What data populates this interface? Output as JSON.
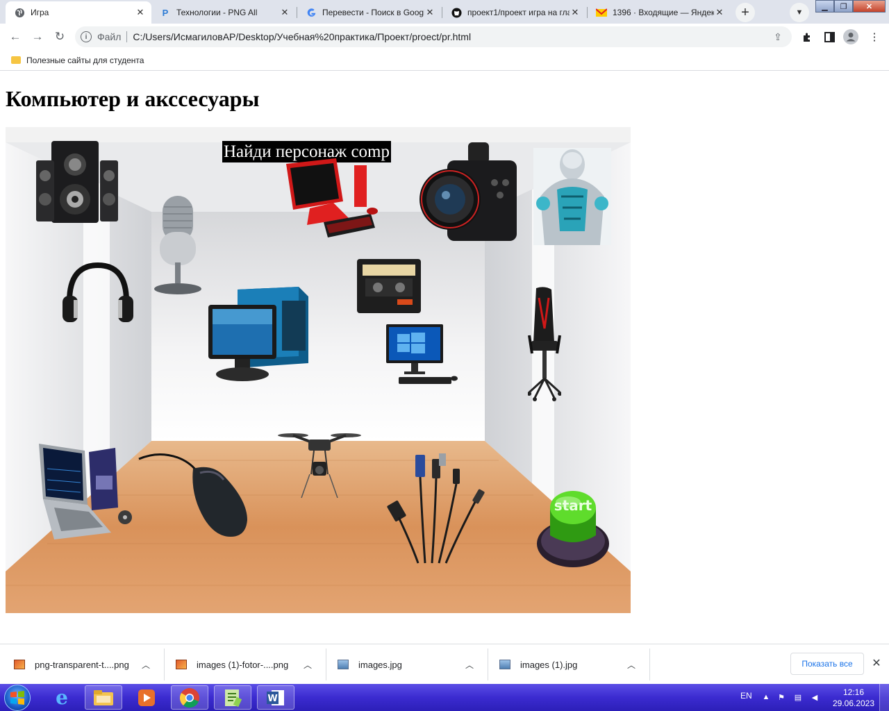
{
  "browser": {
    "tabs": [
      {
        "title": "Игра",
        "icon": "globe-icon",
        "active": true
      },
      {
        "title": "Технологии - PNG All",
        "icon": "pngall-icon",
        "active": false
      },
      {
        "title": "Перевести - Поиск в Google",
        "icon": "google-icon",
        "active": false
      },
      {
        "title": "проект1/проект игра на главной",
        "icon": "github-icon",
        "active": false
      },
      {
        "title": "1396 · Входящие — Яндекс Почта",
        "icon": "mail-icon",
        "active": false
      }
    ],
    "new_tab_symbol": "+",
    "address_scheme": "Файл",
    "address_url": "C:/Users/ИсмагиловАР/Desktop/Учебная%20практика/Проект/proect/pr.html",
    "bookmark_folder": "Полезные сайты для студента"
  },
  "page": {
    "heading": "Компьютер и акссесуары",
    "game_caption": "Найди персонаж comp",
    "start_button_label": "start"
  },
  "downloads": {
    "items": [
      {
        "name": "png-transparent-t....png",
        "type": "png"
      },
      {
        "name": "images (1)-fotor-....png",
        "type": "png"
      },
      {
        "name": "images.jpg",
        "type": "jpg"
      },
      {
        "name": "images (1).jpg",
        "type": "jpg"
      }
    ],
    "show_all": "Показать все"
  },
  "taskbar": {
    "language": "EN",
    "time": "12:16",
    "date": "29.06.2023"
  },
  "colors": {
    "tabstrip": "#dfe3ec",
    "taskbar": "#3b2bd0",
    "floor": "#d9925a",
    "start_button": "#3fbf1f"
  }
}
